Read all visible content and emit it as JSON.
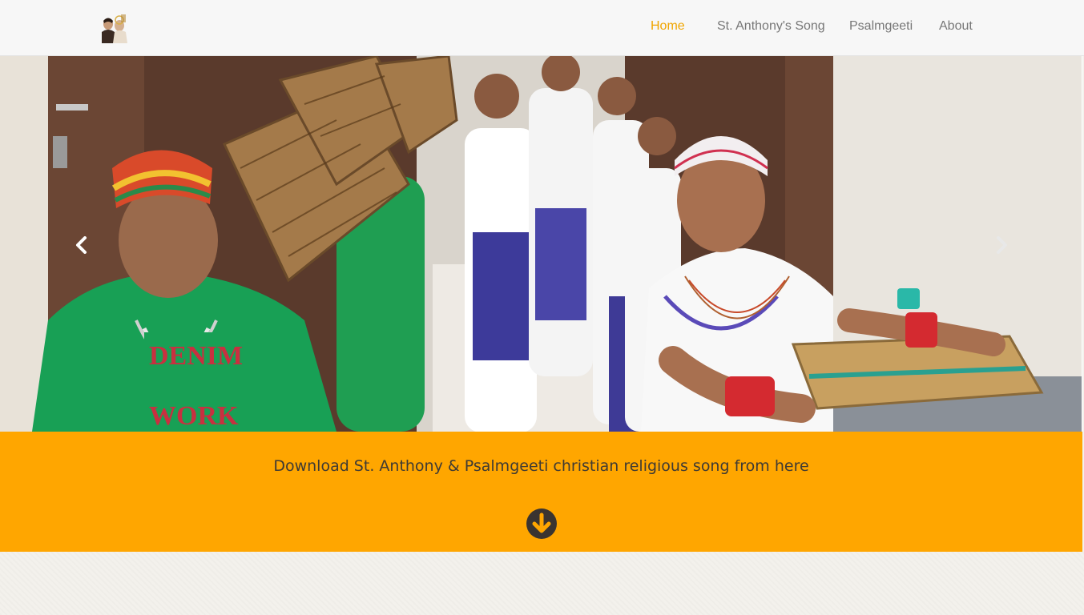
{
  "nav": {
    "logo_alt": "St. Anthony",
    "items": [
      {
        "label": "Home",
        "active": true
      },
      {
        "label": "St. Anthony's Song",
        "active": false
      },
      {
        "label": "Psalmgeeti",
        "active": false
      },
      {
        "label": "About",
        "active": false
      }
    ]
  },
  "hero": {
    "image_subject": "children in traditional dress carrying woven baskets",
    "prev_icon": "chevron-left-icon",
    "next_icon": "chevron-right-icon"
  },
  "banner": {
    "text": "Download St. Anthony & Psalmgeeti christian religious song from here",
    "download_icon": "arrow-down-circle-icon"
  },
  "colors": {
    "accent": "#ffa600",
    "nav_active": "#f0a500",
    "nav_text": "#777777",
    "banner_text": "#3e3a34"
  }
}
